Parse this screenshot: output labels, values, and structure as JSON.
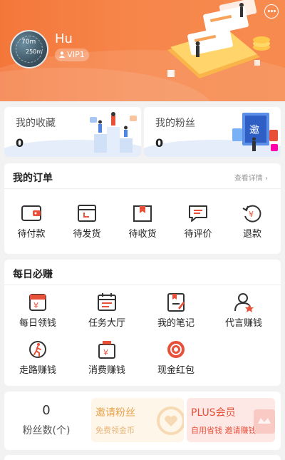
{
  "profile": {
    "username": "Hu",
    "vip_label": "VIP1",
    "avatar_text_1": "70m",
    "avatar_text_2": "250m"
  },
  "stats": {
    "favorites_label": "我的收藏",
    "favorites_count": "0",
    "followers_label": "我的粉丝",
    "followers_count": "0"
  },
  "orders": {
    "title": "我的订单",
    "detail_link": "查看详情 ›",
    "items": [
      {
        "label": "待付款",
        "icon": "wallet-icon"
      },
      {
        "label": "待发货",
        "icon": "box-pending-icon"
      },
      {
        "label": "待收货",
        "icon": "package-icon"
      },
      {
        "label": "待评价",
        "icon": "comment-icon"
      },
      {
        "label": "退款",
        "icon": "refund-icon"
      }
    ]
  },
  "daily": {
    "title": "每日必赚",
    "items": [
      {
        "label": "每日领钱",
        "icon": "daily-money-icon"
      },
      {
        "label": "任务大厅",
        "icon": "task-hall-icon"
      },
      {
        "label": "我的笔记",
        "icon": "notes-icon"
      },
      {
        "label": "代言赚钱",
        "icon": "endorse-icon"
      },
      {
        "label": "走路赚钱",
        "icon": "walking-icon"
      },
      {
        "label": "消费赚钱",
        "icon": "shopping-bag-icon"
      },
      {
        "label": "现金红包",
        "icon": "red-packet-icon"
      }
    ]
  },
  "fans": {
    "count": "0",
    "count_label": "粉丝数(个)",
    "invite_title": "邀请粉丝",
    "invite_subtitle": "免费领金币",
    "plus_title": "PLUS会员",
    "plus_subtitle": "自用省钱 邀请赚钱"
  },
  "colors": {
    "header": "#f57a3e",
    "accent": "#e8503a",
    "icon_dark": "#333333",
    "invite_bg": "#fff6ea",
    "plus_bg": "#fde8e6"
  }
}
